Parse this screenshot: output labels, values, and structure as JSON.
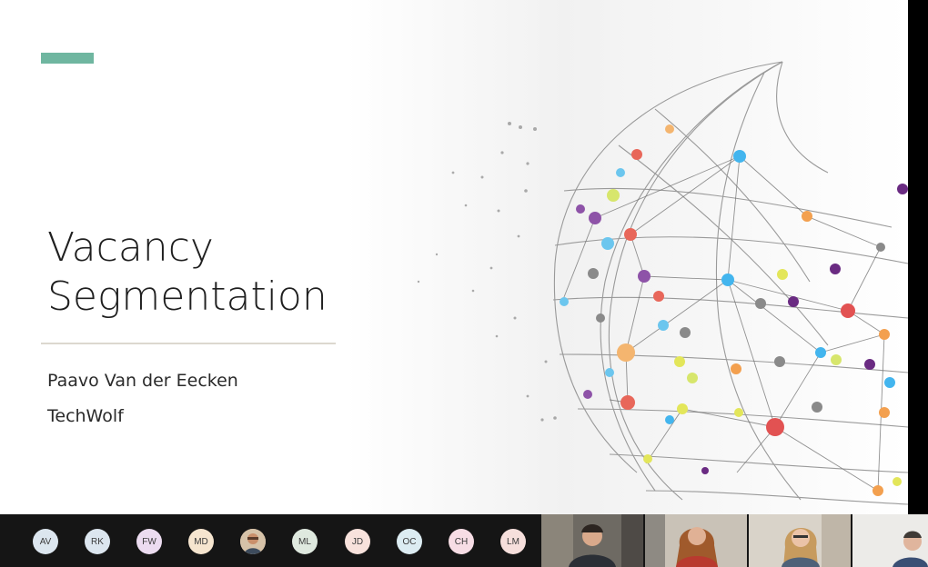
{
  "slide": {
    "title_line1": "Vacancy",
    "title_line2": "Segmentation",
    "author": "Paavo Van der Eecken",
    "organization": "TechWolf",
    "accent_color": "#6fb6a0"
  },
  "participants": [
    {
      "initials": "AV",
      "color": "#dce6ef"
    },
    {
      "initials": "RK",
      "color": "#dce6ef"
    },
    {
      "initials": "FW",
      "color": "#ecdcf0"
    },
    {
      "initials": "MD",
      "color": "#f6e5cf"
    },
    {
      "initials": "ML",
      "color": "#dfe9df"
    },
    {
      "initials": "JD",
      "color": "#f8e2dc"
    },
    {
      "initials": "OC",
      "color": "#dcecf2"
    },
    {
      "initials": "CH",
      "color": "#f7dde5"
    },
    {
      "initials": "LM",
      "color": "#f6dfdc"
    }
  ]
}
